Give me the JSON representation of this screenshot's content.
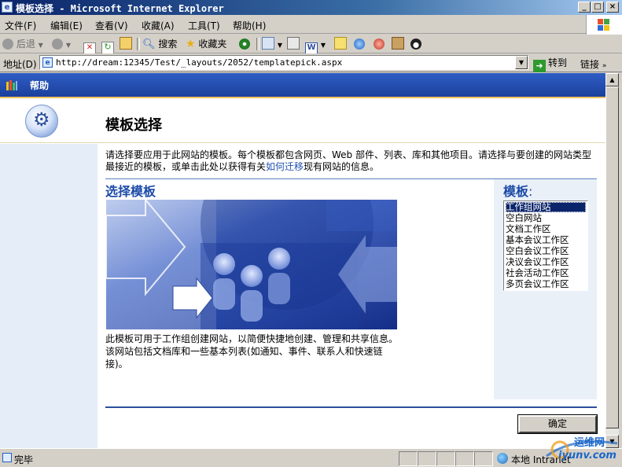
{
  "window": {
    "title": "模板选择 - Microsoft Internet Explorer",
    "controls": {
      "minimize": "_",
      "maximize": "□",
      "close": "×"
    }
  },
  "menu": [
    "文件(F)",
    "编辑(E)",
    "查看(V)",
    "收藏(A)",
    "工具(T)",
    "帮助(H)"
  ],
  "toolbar": {
    "back": "后退",
    "search": "搜索",
    "favorites": "收藏夹"
  },
  "address": {
    "label": "地址(D)",
    "url": "http://dream:12345/Test/_layouts/2052/templatepick.aspx",
    "go": "转到",
    "links": "链接"
  },
  "sharepoint": {
    "help": "帮助",
    "page_title": "模板选择",
    "description_1": "请选择要应用于此网站的模板。每个模板都包含网页、Web 部件、列表、库和其他项目。请选择与要创建的网站类型最接近的模板，或单击此处以获得有关",
    "description_link": "如何迁移",
    "description_2": "现有网站的信息。",
    "section_title": "选择模板",
    "templates_label": "模板",
    "templates_colon": ":",
    "templates": [
      "工作组网站",
      "空白网站",
      "文档工作区",
      "基本会议工作区",
      "空白会议工作区",
      "决议会议工作区",
      "社会活动工作区",
      "多页会议工作区"
    ],
    "selected_index": 0,
    "preview_caption": "此模板可用于工作组创建网站，以简便快捷地创建、管理和共享信息。该网站包括文档库和一些基本列表(如通知、事件、联系人和快速链接)。",
    "ok": "确定"
  },
  "status": {
    "text": "完毕",
    "zone": "本地 Intranet"
  },
  "watermark": {
    "line1": "运维网",
    "line2": "iyunv.com"
  },
  "colors": {
    "title_bar": "#0a246a",
    "sharepoint_bar": "#2f5ec4",
    "accent_text": "#1c4aa8",
    "selection": "#0a246a"
  }
}
